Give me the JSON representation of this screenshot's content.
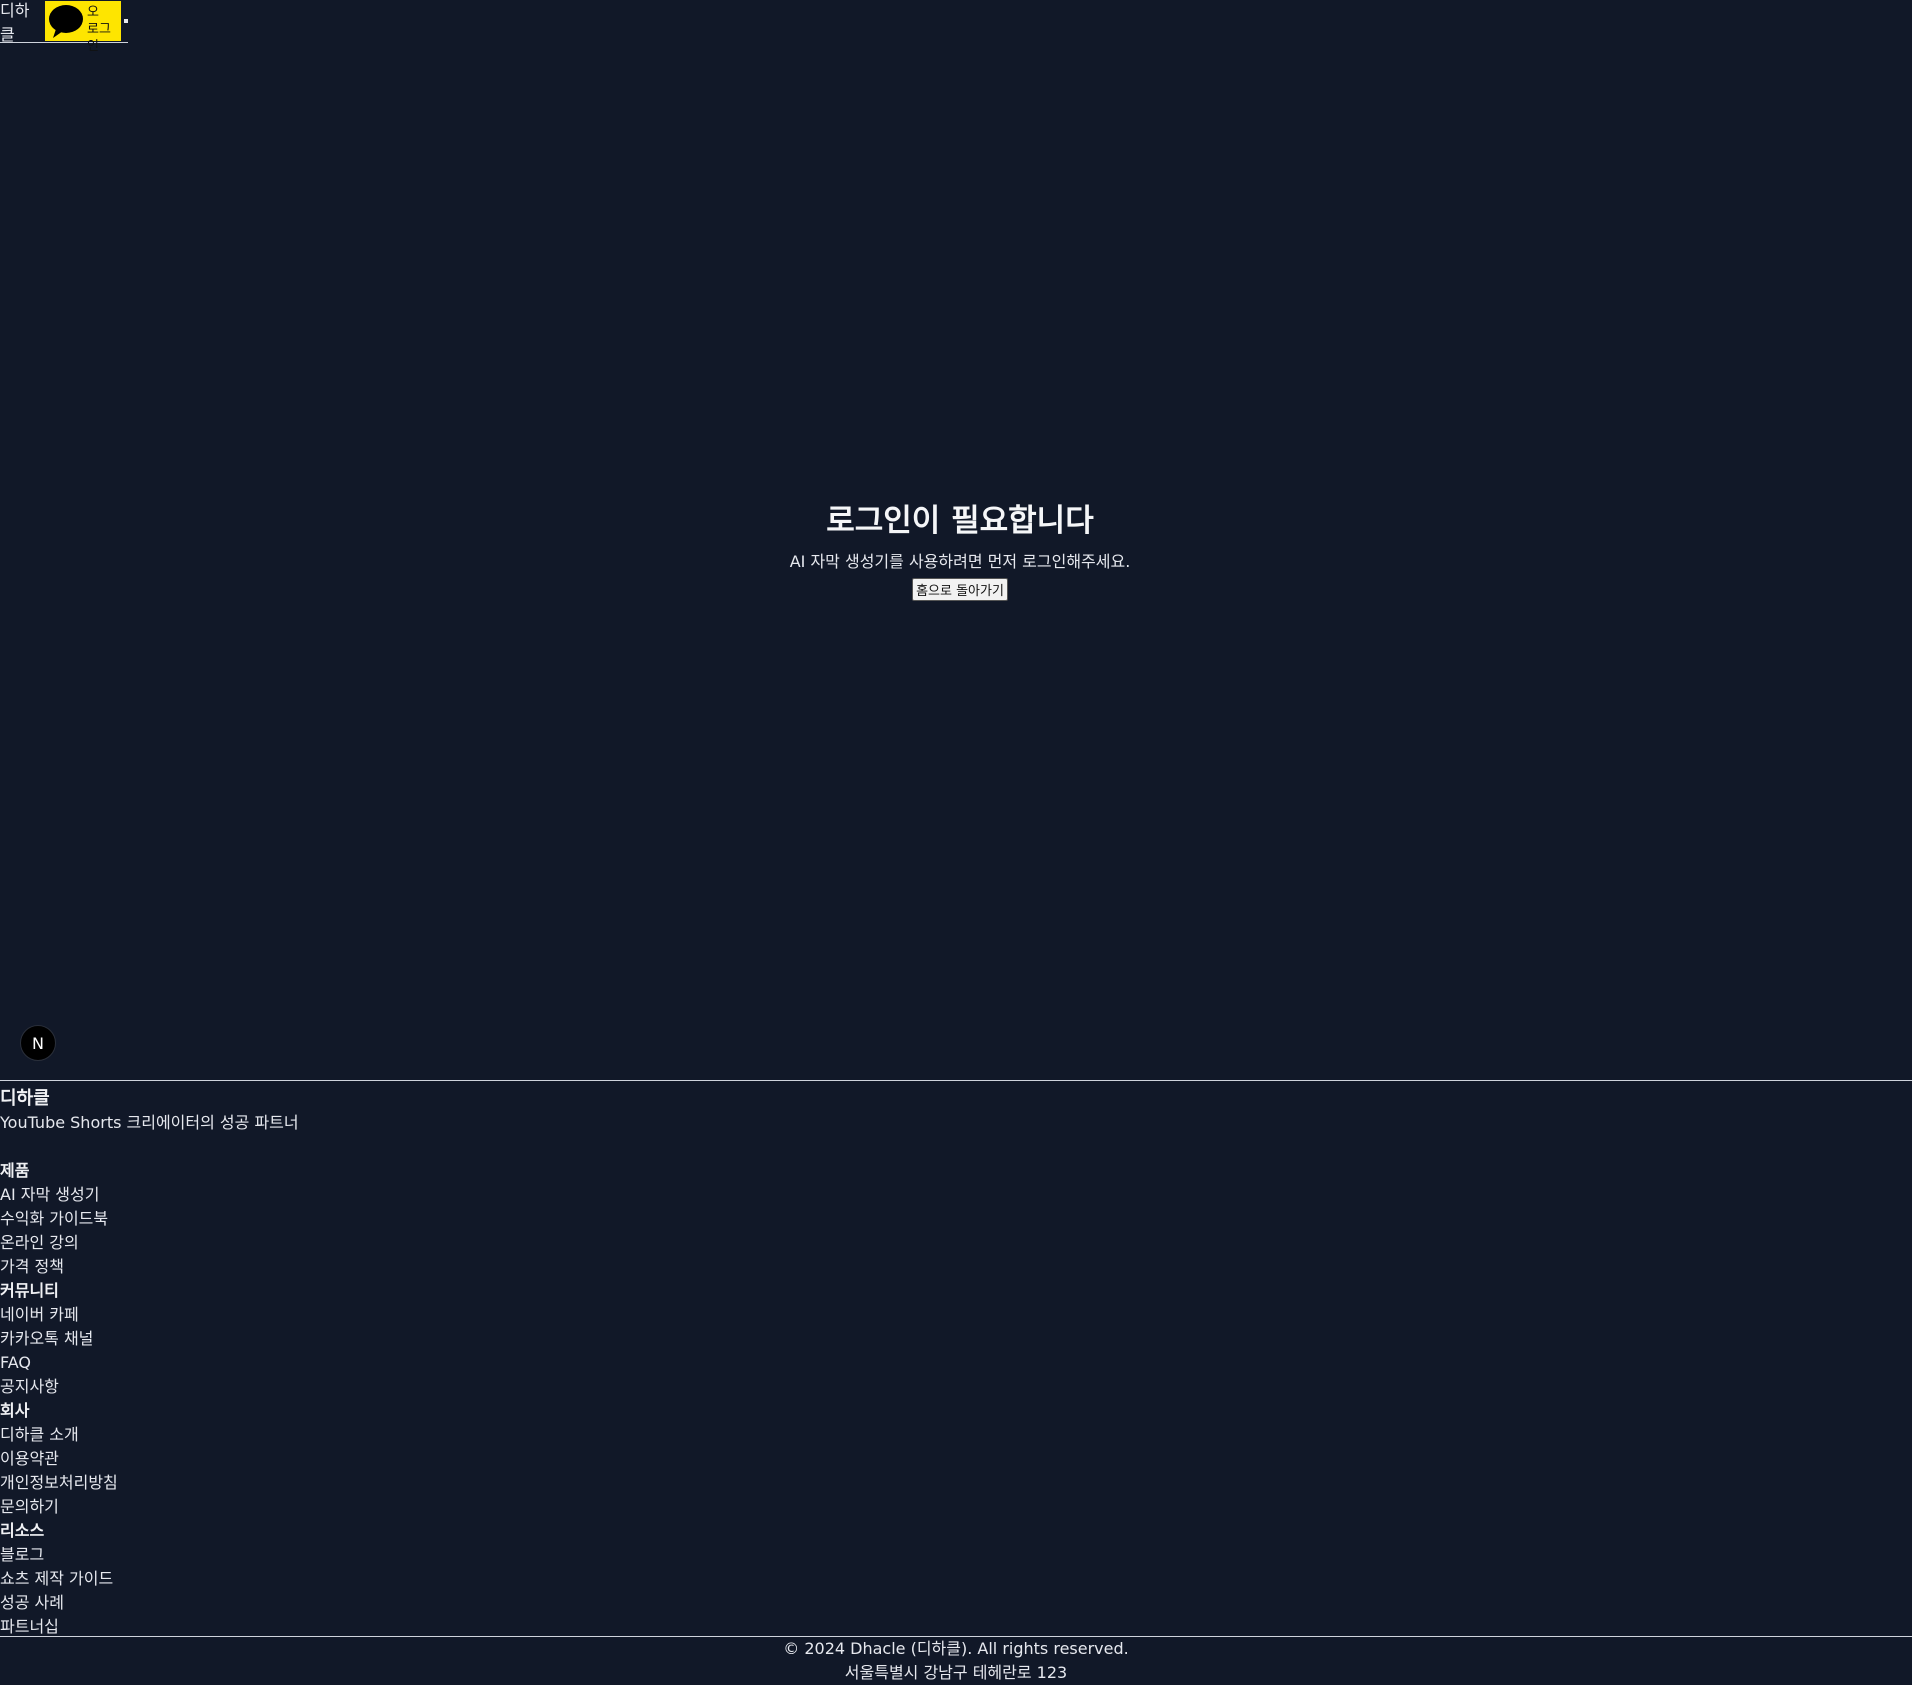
{
  "header": {
    "brand": "디하클",
    "kakao_login_line1": "카카오",
    "kakao_login_line2": "로그인",
    "kakao_icon": "speech-bubble-icon"
  },
  "main": {
    "title": "로그인이 필요합니다",
    "subtitle": "AI 자막 생성기를 사용하려면 먼저 로그인해주세요.",
    "home_button": "홈으로 돌아가기"
  },
  "badge": {
    "letter": "N"
  },
  "footer": {
    "brand": "디하클",
    "tagline": "YouTube Shorts 크리에이터의 성공 파트너",
    "sections": [
      {
        "title": "제품",
        "links": [
          "AI 자막 생성기",
          "수익화 가이드북",
          "온라인 강의",
          "가격 정책"
        ]
      },
      {
        "title": "커뮤니티",
        "links": [
          "네이버 카페",
          "카카오톡 채널",
          "FAQ",
          "공지사항"
        ]
      },
      {
        "title": "회사",
        "links": [
          "디하클 소개",
          "이용약관",
          "개인정보처리방침",
          "문의하기"
        ]
      },
      {
        "title": "리소스",
        "links": [
          "블로그",
          "쇼츠 제작 가이드",
          "성공 사례",
          "파트너십"
        ]
      }
    ],
    "copyright": "© 2024 Dhacle (디하클). All rights reserved.",
    "address": "서울특별시 강남구 테헤란로 123"
  },
  "colors": {
    "background": "#111828",
    "kakao_yellow": "#FEE500"
  }
}
